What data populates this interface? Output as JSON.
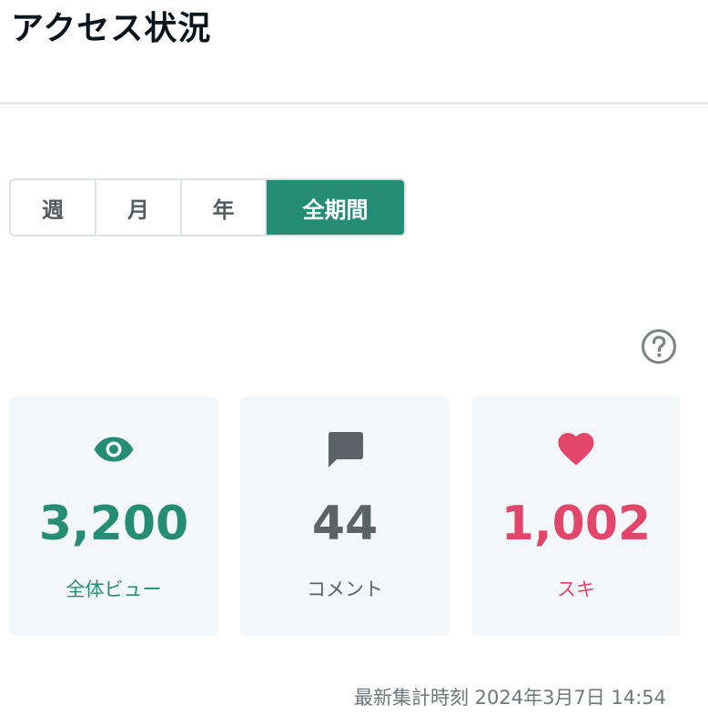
{
  "header": {
    "title": "アクセス状況"
  },
  "period_tabs": {
    "items": [
      {
        "label": "週"
      },
      {
        "label": "月"
      },
      {
        "label": "年"
      },
      {
        "label": "全期間"
      }
    ],
    "selected": "全期間"
  },
  "help": {
    "icon": "question-circle-icon"
  },
  "stats": {
    "views": {
      "icon": "eye-icon",
      "value": "3,200",
      "label": "全体ビュー",
      "color": "#258d73"
    },
    "comments": {
      "icon": "comment-icon",
      "value": "44",
      "label": "コメント",
      "color": "#5c6367"
    },
    "likes": {
      "icon": "heart-icon",
      "value": "1,002",
      "label": "スキ",
      "color": "#e2466a"
    }
  },
  "footer": {
    "updated_at": "最新集計時刻 2024年3月7日 14:54"
  },
  "colors": {
    "accent": "#258d73",
    "card_background": "#f4f7f9",
    "like": "#e2466a"
  }
}
